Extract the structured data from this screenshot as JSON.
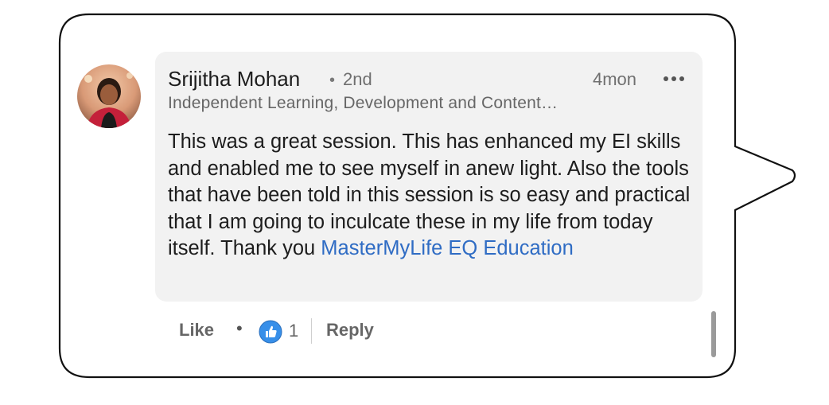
{
  "comment": {
    "author_name": "Srijitha Mohan",
    "separator": "•",
    "connection_degree": "2nd",
    "timestamp": "4mon",
    "headline": "Independent Learning, Development and Content…",
    "text_before_mention": "This was a great session. This has enhanced my EI skills and enabled me to see myself in anew light. Also the tools that have been told in this session is so easy and practical that I am going to inculcate these in my life from today itself. Thank you ",
    "mention": "MasterMyLife EQ Education"
  },
  "actions": {
    "like_label": "Like",
    "separator": "•",
    "reaction_count": "1",
    "reply_label": "Reply"
  },
  "icons": {
    "more": "more-options-icon",
    "like": "thumbs-up-icon"
  },
  "colors": {
    "mention": "#2f6cc4",
    "like_icon": "#378fe9",
    "comment_background": "#f2f2f2"
  }
}
